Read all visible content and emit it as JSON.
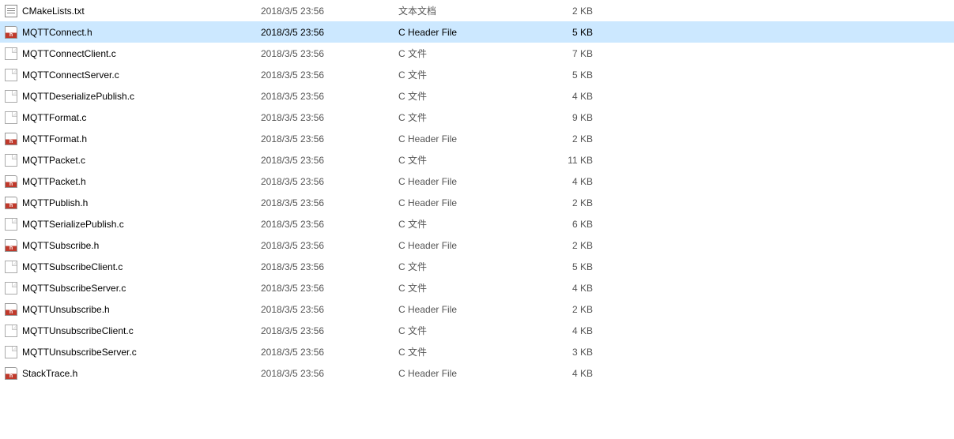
{
  "files": [
    {
      "name": "CMakeLists.txt",
      "date": "2018/3/5 23:56",
      "type": "文本文档",
      "size": "2 KB",
      "icon": "txt",
      "selected": false
    },
    {
      "name": "MQTTConnect.h",
      "date": "2018/3/5 23:56",
      "type": "C Header File",
      "size": "5 KB",
      "icon": "h",
      "selected": true
    },
    {
      "name": "MQTTConnectClient.c",
      "date": "2018/3/5 23:56",
      "type": "C 文件",
      "size": "7 KB",
      "icon": "c",
      "selected": false
    },
    {
      "name": "MQTTConnectServer.c",
      "date": "2018/3/5 23:56",
      "type": "C 文件",
      "size": "5 KB",
      "icon": "c",
      "selected": false
    },
    {
      "name": "MQTTDeserializePublish.c",
      "date": "2018/3/5 23:56",
      "type": "C 文件",
      "size": "4 KB",
      "icon": "c",
      "selected": false
    },
    {
      "name": "MQTTFormat.c",
      "date": "2018/3/5 23:56",
      "type": "C 文件",
      "size": "9 KB",
      "icon": "c",
      "selected": false
    },
    {
      "name": "MQTTFormat.h",
      "date": "2018/3/5 23:56",
      "type": "C Header File",
      "size": "2 KB",
      "icon": "h",
      "selected": false
    },
    {
      "name": "MQTTPacket.c",
      "date": "2018/3/5 23:56",
      "type": "C 文件",
      "size": "11 KB",
      "icon": "c",
      "selected": false
    },
    {
      "name": "MQTTPacket.h",
      "date": "2018/3/5 23:56",
      "type": "C Header File",
      "size": "4 KB",
      "icon": "h",
      "selected": false
    },
    {
      "name": "MQTTPublish.h",
      "date": "2018/3/5 23:56",
      "type": "C Header File",
      "size": "2 KB",
      "icon": "h",
      "selected": false
    },
    {
      "name": "MQTTSerializePublish.c",
      "date": "2018/3/5 23:56",
      "type": "C 文件",
      "size": "6 KB",
      "icon": "c",
      "selected": false
    },
    {
      "name": "MQTTSubscribe.h",
      "date": "2018/3/5 23:56",
      "type": "C Header File",
      "size": "2 KB",
      "icon": "h",
      "selected": false
    },
    {
      "name": "MQTTSubscribeClient.c",
      "date": "2018/3/5 23:56",
      "type": "C 文件",
      "size": "5 KB",
      "icon": "c",
      "selected": false
    },
    {
      "name": "MQTTSubscribeServer.c",
      "date": "2018/3/5 23:56",
      "type": "C 文件",
      "size": "4 KB",
      "icon": "c",
      "selected": false
    },
    {
      "name": "MQTTUnsubscribe.h",
      "date": "2018/3/5 23:56",
      "type": "C Header File",
      "size": "2 KB",
      "icon": "h",
      "selected": false
    },
    {
      "name": "MQTTUnsubscribeClient.c",
      "date": "2018/3/5 23:56",
      "type": "C 文件",
      "size": "4 KB",
      "icon": "c",
      "selected": false
    },
    {
      "name": "MQTTUnsubscribeServer.c",
      "date": "2018/3/5 23:56",
      "type": "C 文件",
      "size": "3 KB",
      "icon": "c",
      "selected": false
    },
    {
      "name": "StackTrace.h",
      "date": "2018/3/5 23:56",
      "type": "C Header File",
      "size": "4 KB",
      "icon": "h",
      "selected": false
    }
  ]
}
